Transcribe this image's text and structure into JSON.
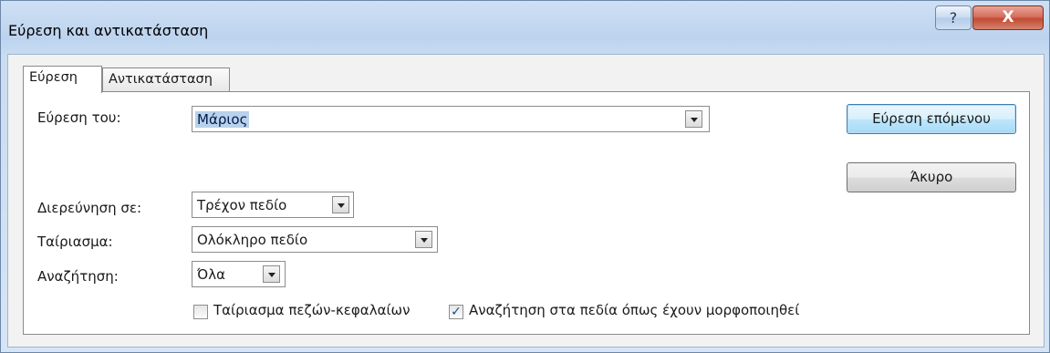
{
  "window": {
    "title": "Εύρεση και αντικατάσταση",
    "help_glyph": "?",
    "close_glyph": "X"
  },
  "tabs": [
    {
      "label": "Εύρεση",
      "active": true
    },
    {
      "label": "Αντικατάσταση",
      "active": false
    }
  ],
  "form": {
    "find_label": "Εύρεση του:",
    "find_value": "Μάριος",
    "lookin_label": "Διερεύνηση σε:",
    "lookin_value": "Τρέχον πεδίο",
    "match_label": "Ταίριασμα:",
    "match_value": "Ολόκληρο πεδίο",
    "search_label": "Αναζήτηση:",
    "search_value": "Όλα"
  },
  "options": {
    "match_case": {
      "label": "Ταίριασμα πεζών-κεφαλαίων",
      "checked": false
    },
    "search_formatted": {
      "label": "Αναζήτηση στα πεδία όπως έχουν μορφοποιηθεί",
      "checked": true
    }
  },
  "buttons": {
    "find_next": "Εύρεση επόμενου",
    "cancel": "Άκυρο"
  }
}
